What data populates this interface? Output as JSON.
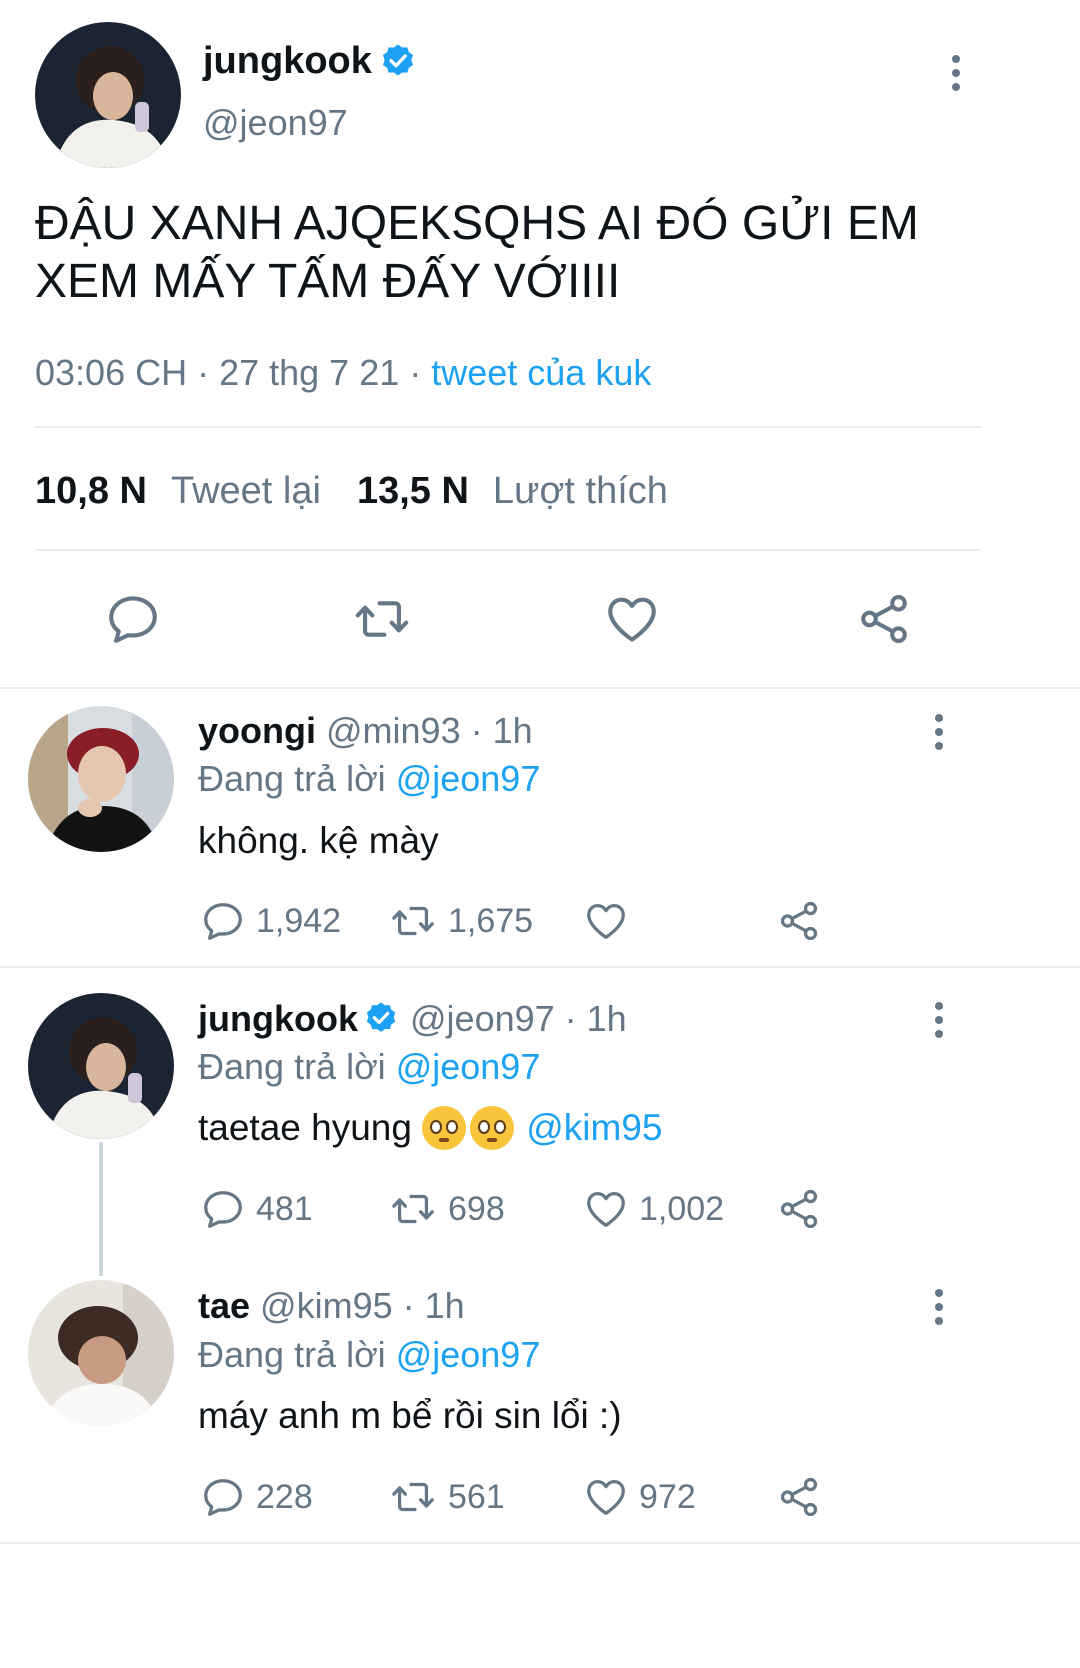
{
  "main_tweet": {
    "name": "jungkook",
    "handle": "@jeon97",
    "text": "ĐẬU XANH AJQEKSQHS AI ĐÓ GỬI EM XEM MẤY TẤM ĐẤY VỚIIII",
    "time": "03:06 CH · 27 thg 7 21 · ",
    "source": "tweet của kuk",
    "retweets_count": "10,8 N",
    "retweets_label": "Tweet lại",
    "likes_count": "13,5 N",
    "likes_label": "Lượt thích"
  },
  "replies": [
    {
      "name": "yoongi",
      "handle": "@min93",
      "time": " · 1h",
      "replying_prefix": "Đang trả lời ",
      "replying_to": "@jeon97",
      "text": "không. kệ mày",
      "comments": "1,942",
      "retweets": "1,675",
      "likes": ""
    },
    {
      "name": "jungkook",
      "handle": "@jeon97",
      "time": " · 1h",
      "replying_prefix": "Đang trả lời ",
      "replying_to": "@jeon97",
      "text": "taetae hyung ",
      "mention": "@kim95",
      "comments": "481",
      "retweets": "698",
      "likes": "1,002"
    },
    {
      "name": "tae",
      "handle": "@kim95",
      "time": " · 1h",
      "replying_prefix": "Đang trả lời ",
      "replying_to": "@jeon97",
      "text": "máy anh m bể rồi sin lổi :)",
      "comments": "228",
      "retweets": "561",
      "likes": "972"
    }
  ],
  "icons": [
    "more-vert-icon",
    "verified-badge-icon",
    "reply-icon",
    "retweet-icon",
    "like-icon",
    "share-icon",
    "pleading-face-emoji"
  ],
  "colors": {
    "accent": "#1da1f2",
    "secondary_text": "#657786",
    "divider": "#e6ecf0"
  }
}
